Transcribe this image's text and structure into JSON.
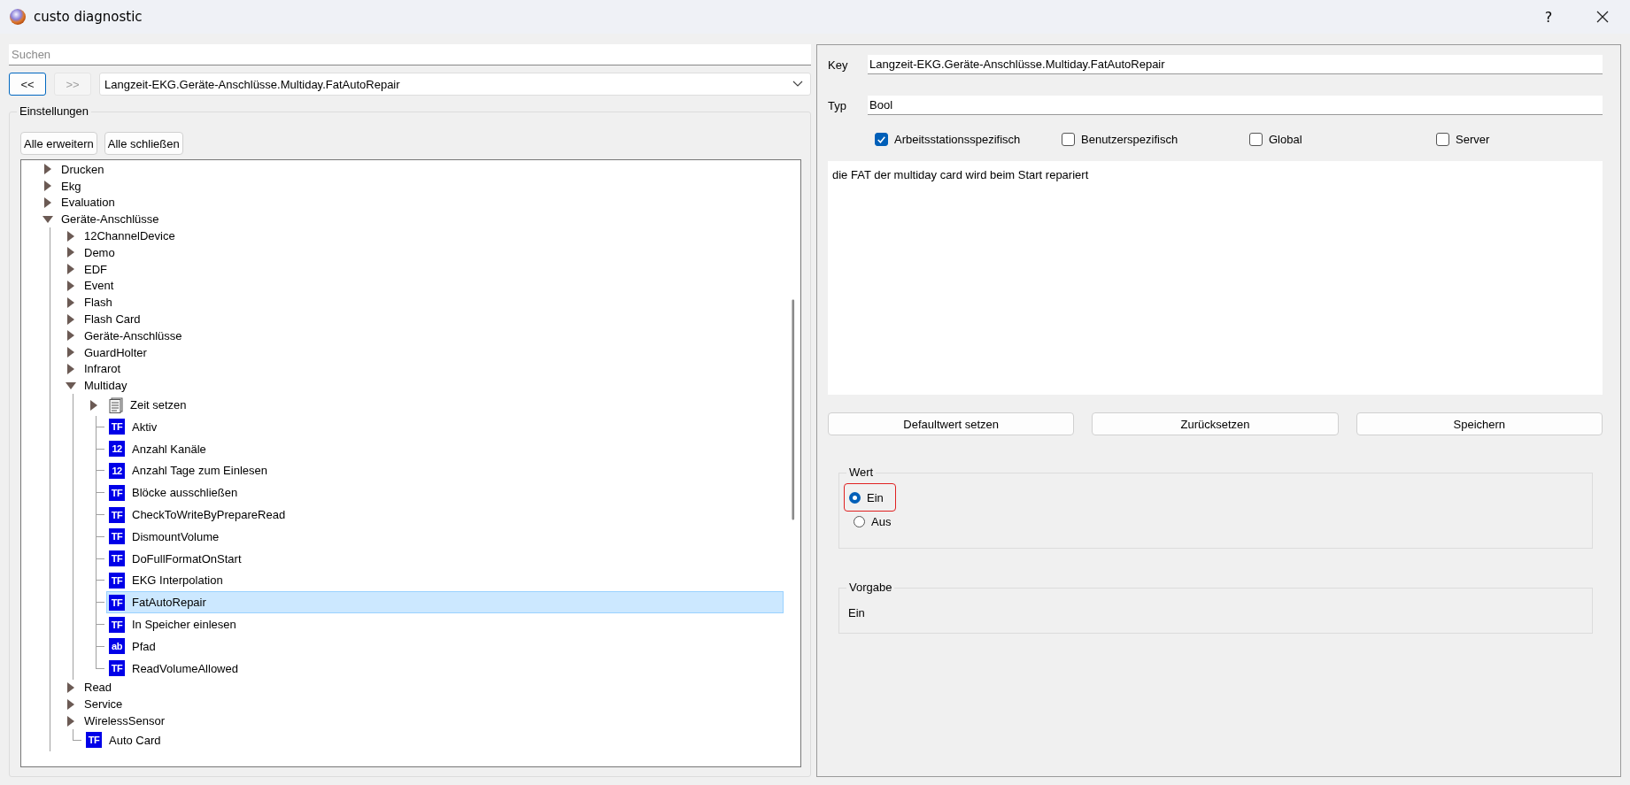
{
  "window": {
    "title": "custo diagnostic",
    "help": "?"
  },
  "search": {
    "placeholder": "Suchen"
  },
  "nav": {
    "back": "<<",
    "forward": ">>",
    "forward_disabled": true,
    "path": "Langzeit-EKG.Geräte-Anschlüsse.Multiday.FatAutoRepair"
  },
  "settings": {
    "title": "Einstellungen",
    "buttons": [
      "Alle erweitern",
      "Alle schließen"
    ],
    "tree": [
      {
        "label": "Drucken",
        "kind": "folder",
        "expanded": false,
        "selected": false
      },
      {
        "label": "Ekg",
        "kind": "folder",
        "expanded": false,
        "selected": false
      },
      {
        "label": "Evaluation",
        "kind": "folder",
        "expanded": false,
        "selected": false
      },
      {
        "label": "Geräte-Anschlüsse",
        "kind": "folder",
        "expanded": true,
        "selected": false,
        "children": [
          {
            "label": "12ChannelDevice",
            "kind": "folder",
            "expanded": false,
            "selected": false
          },
          {
            "label": "Demo",
            "kind": "folder",
            "expanded": false,
            "selected": false
          },
          {
            "label": "EDF",
            "kind": "folder",
            "expanded": false,
            "selected": false
          },
          {
            "label": "Event",
            "kind": "folder",
            "expanded": false,
            "selected": false
          },
          {
            "label": "Flash",
            "kind": "folder",
            "expanded": false,
            "selected": false
          },
          {
            "label": "Flash Card",
            "kind": "folder",
            "expanded": false,
            "selected": false
          },
          {
            "label": "Geräte-Anschlüsse",
            "kind": "folder",
            "expanded": false,
            "selected": false
          },
          {
            "label": "GuardHolter",
            "kind": "folder",
            "expanded": false,
            "selected": false
          },
          {
            "label": "Infrarot",
            "kind": "folder",
            "expanded": false,
            "selected": false
          },
          {
            "label": "Multiday",
            "kind": "folder",
            "expanded": true,
            "selected": false,
            "children": [
              {
                "label": "Zeit setzen",
                "kind": "document",
                "expanded": false,
                "selected": false
              },
              {
                "label": "Aktiv",
                "kind": "setting",
                "badge": "TF",
                "selected": false
              },
              {
                "label": "Anzahl Kanäle",
                "kind": "setting",
                "badge": "12",
                "selected": false
              },
              {
                "label": "Anzahl Tage zum Einlesen",
                "kind": "setting",
                "badge": "12",
                "selected": false
              },
              {
                "label": "Blöcke ausschließen",
                "kind": "setting",
                "badge": "TF",
                "selected": false
              },
              {
                "label": "CheckToWriteByPrepareRead",
                "kind": "setting",
                "badge": "TF",
                "selected": false
              },
              {
                "label": "DismountVolume",
                "kind": "setting",
                "badge": "TF",
                "selected": false
              },
              {
                "label": "DoFullFormatOnStart",
                "kind": "setting",
                "badge": "TF",
                "selected": false
              },
              {
                "label": "EKG Interpolation",
                "kind": "setting",
                "badge": "TF",
                "selected": false
              },
              {
                "label": "FatAutoRepair",
                "kind": "setting",
                "badge": "TF",
                "selected": true
              },
              {
                "label": "In Speicher einlesen",
                "kind": "setting",
                "badge": "TF",
                "selected": false
              },
              {
                "label": "Pfad",
                "kind": "setting",
                "badge": "ab",
                "selected": false
              },
              {
                "label": "ReadVolumeAllowed",
                "kind": "setting",
                "badge": "TF",
                "selected": false
              }
            ]
          },
          {
            "label": "Read",
            "kind": "folder",
            "expanded": false,
            "selected": false
          },
          {
            "label": "Service",
            "kind": "folder",
            "expanded": false,
            "selected": false
          },
          {
            "label": "WirelessSensor",
            "kind": "folder",
            "expanded": false,
            "selected": false
          },
          {
            "label": "Auto Card",
            "kind": "setting",
            "badge": "TF",
            "selected": false
          }
        ]
      }
    ]
  },
  "detail": {
    "key_label": "Key",
    "key": "Langzeit-EKG.Geräte-Anschlüsse.Multiday.FatAutoRepair",
    "type_label": "Typ",
    "type": "Bool",
    "scopes": [
      {
        "label": "Arbeitsstationsspezifisch",
        "checked": true
      },
      {
        "label": "Benutzerspezifisch",
        "checked": false
      },
      {
        "label": "Global",
        "checked": false
      },
      {
        "label": "Server",
        "checked": false
      }
    ],
    "description": "die FAT der multiday card wird beim Start repariert",
    "buttons": [
      "Defaultwert setzen",
      "Zurücksetzen",
      "Speichern"
    ],
    "value_group": {
      "title": "Wert",
      "options": [
        {
          "label": "Ein",
          "selected": true,
          "focused": true
        },
        {
          "label": "Aus",
          "selected": false,
          "focused": false
        }
      ]
    },
    "default_group": {
      "title": "Vorgabe",
      "value": "Ein"
    }
  }
}
